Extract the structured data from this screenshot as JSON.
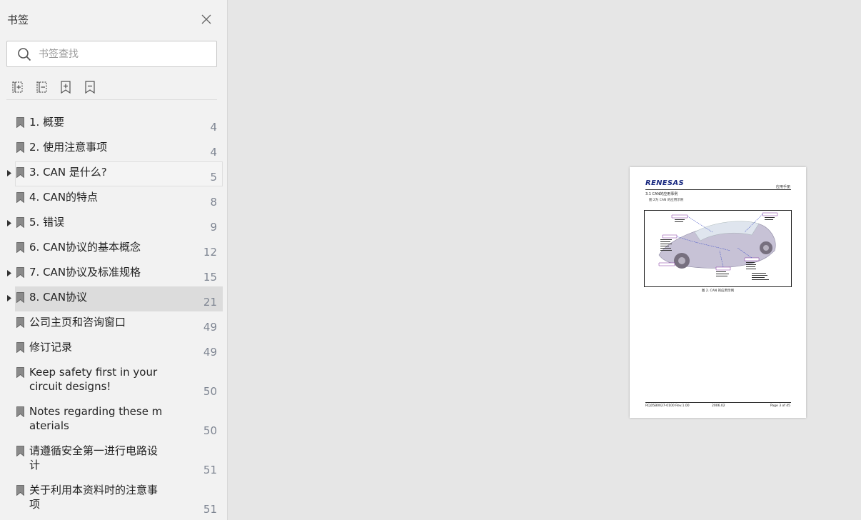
{
  "sidebar": {
    "title": "书签",
    "search_placeholder": "书签查找",
    "toolbar": [
      "expand-all",
      "collapse-all",
      "add-bookmark",
      "remove-bookmark"
    ],
    "bookmarks": [
      {
        "label": "1. 概要",
        "page": "4",
        "expandable": false
      },
      {
        "label": "2. 使用注意事项",
        "page": "4",
        "expandable": false
      },
      {
        "label": "3. CAN 是什么?",
        "page": "5",
        "expandable": true
      },
      {
        "label": "4. CAN的特点",
        "page": "8",
        "expandable": false
      },
      {
        "label": "5. 错误",
        "page": "9",
        "expandable": true
      },
      {
        "label": "6. CAN协议的基本概念",
        "page": "12",
        "expandable": false
      },
      {
        "label": "7. CAN协议及标准规格",
        "page": "15",
        "expandable": true
      },
      {
        "label": "8. CAN协议",
        "page": "21",
        "expandable": true
      },
      {
        "label": "公司主页和咨询窗口",
        "page": "49",
        "expandable": false
      },
      {
        "label": "修订记录",
        "page": "49",
        "expandable": false
      },
      {
        "label": "Keep safety first in your circuit designs!",
        "page": "50",
        "expandable": false
      },
      {
        "label": "Notes regarding these materials",
        "page": "50",
        "expandable": false
      },
      {
        "label": "请遵循安全第一进行电路设计",
        "page": "51",
        "expandable": false
      },
      {
        "label": "关于利用本资料时的注意事项",
        "page": "51",
        "expandable": false
      }
    ]
  },
  "document": {
    "logo": "RENESAS",
    "header_right": "应用手册",
    "section": "3.1      CAN的应用事例",
    "subtitle": "图 2为 CAN 的应用示例",
    "figure_caption": "图 2.   CAN 的应用示例",
    "footer_left": "RCJ05B0027-0100 Rev.1.00",
    "footer_center": "2006.02",
    "footer_right": "Page 3 of 45"
  },
  "colors": {
    "sidebar_bg": "#f2f2f2",
    "selected_row": "#dcdcdc",
    "page_number": "#7e8592",
    "logo": "#1a2a80"
  }
}
